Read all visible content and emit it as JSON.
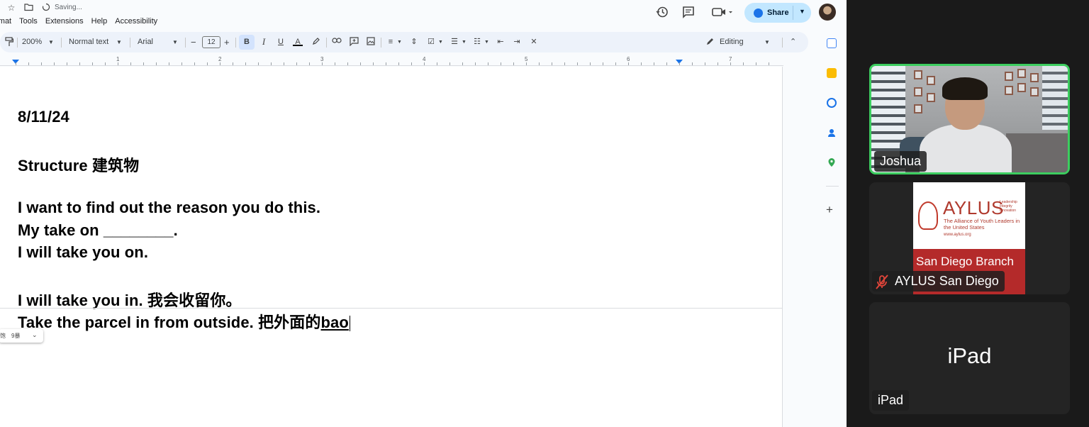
{
  "docs": {
    "status": "Saving...",
    "menu": [
      "ormat",
      "Tools",
      "Extensions",
      "Help",
      "Accessibility"
    ],
    "share_label": "Share",
    "toolbar": {
      "zoom": "200%",
      "style": "Normal text",
      "font": "Arial",
      "font_size": "12",
      "bold": "B",
      "italic": "I",
      "underline": "U",
      "text_color": "A",
      "mode": "Editing"
    },
    "ruler": [
      "1",
      "2",
      "3",
      "4",
      "5",
      "6",
      "7"
    ],
    "content": {
      "date": "8/11/24",
      "structure": "Structure 建筑物",
      "line1": "I want to find out the reason you do this.",
      "line2": "My take on ________.",
      "line3": "I will take you on.",
      "line4": "I will take you in. 我会收留你。",
      "line5_plain": "Take the parcel in from outside. 把外面的",
      "line5_underlined": "bao"
    },
    "ime_popup": {
      "candidate": "饱",
      "second": "9暴"
    }
  },
  "zoom": {
    "participants": [
      {
        "name": "Joshua"
      },
      {
        "name": "AYLUS San Diego"
      },
      {
        "name": "iPad",
        "center_text": "iPad"
      }
    ],
    "aylus_logo": {
      "wordmark": "AYLUS",
      "motto": "Leadership Integrity Innovation",
      "subtitle": "The Alliance of Youth Leaders in the United States",
      "website": "www.aylus.org",
      "branch": "San Diego Branch"
    }
  },
  "colors": {
    "share_bg": "#c2e7ff",
    "active_speaker": "#3ccd5f",
    "aylus_red": "#b42a2a"
  }
}
